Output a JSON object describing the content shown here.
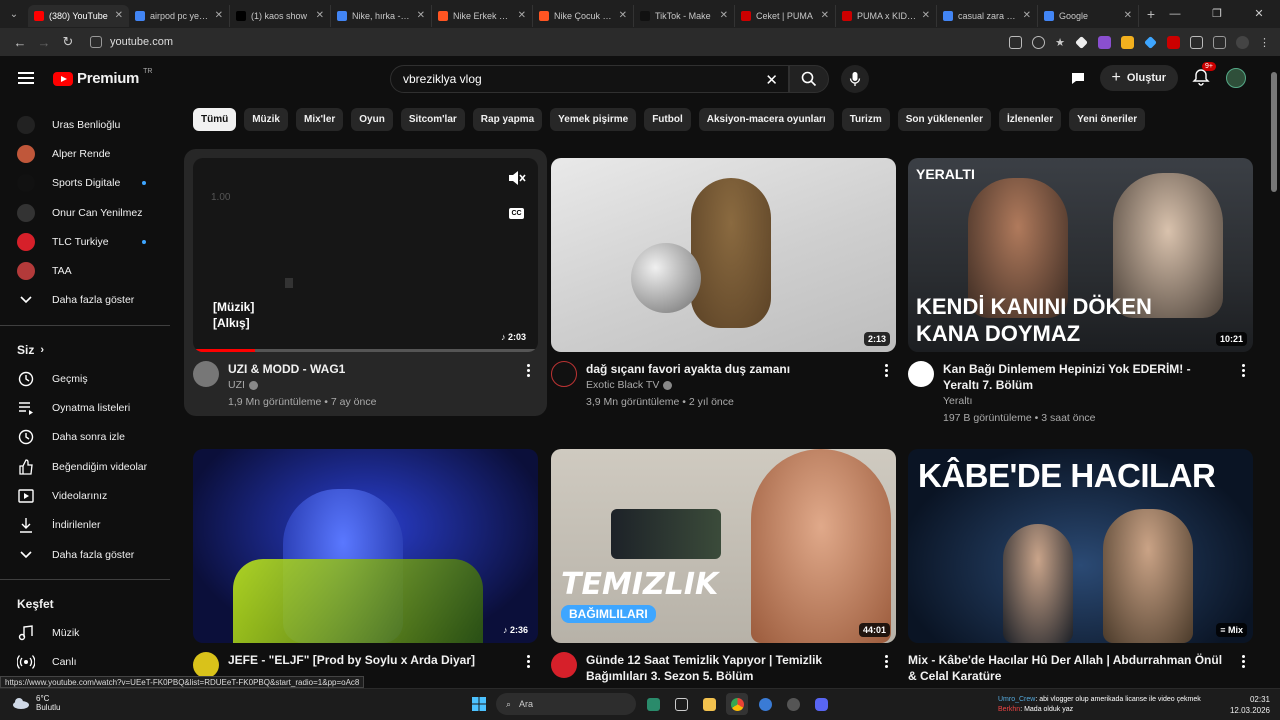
{
  "browser": {
    "tabs": [
      {
        "title": "(380) YouTube",
        "color": "#ff0000",
        "active": true
      },
      {
        "title": "airpod pc ye nasıl",
        "color": "#4285f4",
        "active": false
      },
      {
        "title": "(1) kaos show",
        "color": "#000000",
        "active": false
      },
      {
        "title": "Nike, hırka - Go",
        "color": "#4285f4",
        "active": false
      },
      {
        "title": "Nike Erkek Swe",
        "color": "#ff5522",
        "active": false
      },
      {
        "title": "Nike Çocuk Swe",
        "color": "#ff5522",
        "active": false
      },
      {
        "title": "TikTok - Make",
        "color": "#111111",
        "active": false
      },
      {
        "title": "Ceket | PUMA",
        "color": "#cc0000",
        "active": false
      },
      {
        "title": "PUMA x KIDSU",
        "color": "#cc0000",
        "active": false
      },
      {
        "title": "casual zara par",
        "color": "#4285f4",
        "active": false
      },
      {
        "title": "Google",
        "color": "#4285f4",
        "active": false
      }
    ],
    "url": "youtube.com"
  },
  "header": {
    "logo_text": "Premium",
    "logo_region": "TR",
    "search_value": "vbreziklya vlog",
    "create_label": "Oluştur",
    "notif_badge": "9+"
  },
  "sidebar": {
    "subscriptions": [
      {
        "label": "Uras Benlioğlu",
        "color": "#222222",
        "dot": false
      },
      {
        "label": "Alper Rende",
        "color": "#c0573a",
        "dot": false
      },
      {
        "label": "Sports Digitale",
        "color": "#111111",
        "dot": true
      },
      {
        "label": "Onur Can Yenilmez",
        "color": "#333333",
        "dot": false
      },
      {
        "label": "TLC Turkiye",
        "color": "#d6202a",
        "dot": true
      },
      {
        "label": "TAA",
        "color": "#b33a3a",
        "dot": false
      }
    ],
    "show_more": "Daha fazla göster",
    "you_title": "Siz",
    "you_items": [
      {
        "label": "Geçmiş",
        "icon": "history-icon"
      },
      {
        "label": "Oynatma listeleri",
        "icon": "playlists-icon"
      },
      {
        "label": "Daha sonra izle",
        "icon": "watch-later-icon"
      },
      {
        "label": "Beğendiğim videolar",
        "icon": "like-icon"
      },
      {
        "label": "Videolarınız",
        "icon": "your-videos-icon"
      },
      {
        "label": "İndirilenler",
        "icon": "downloads-icon"
      }
    ],
    "show_more_2": "Daha fazla göster",
    "explore_title": "Keşfet",
    "explore_items": [
      {
        "label": "Müzik",
        "icon": "music-icon"
      },
      {
        "label": "Canlı",
        "icon": "live-icon"
      }
    ]
  },
  "chips": [
    "Tümü",
    "Müzik",
    "Mix'ler",
    "Oyun",
    "Sitcom'lar",
    "Rap yapma",
    "Yemek pişirme",
    "Futbol",
    "Aksiyon-macera oyunları",
    "Turizm",
    "Son yüklenenler",
    "İzlenenler",
    "Yeni öneriler"
  ],
  "videos": [
    {
      "title": "UZI & MODD - WAG1",
      "channel": "UZI",
      "verified": true,
      "stats": "1,9 Mn görüntüleme • 7 ay önce",
      "duration": "2:03",
      "preview_caption_1": "[Müzik]",
      "preview_caption_2": "[Alkış]",
      "preview_time": "1.00",
      "progress": 0.18
    },
    {
      "title": "dağ sıçanı favori ayakta duş zamanı",
      "channel": "Exotic Black TV",
      "verified": true,
      "stats": "3,9 Mn görüntüleme • 2 yıl önce",
      "duration": "2:13"
    },
    {
      "title": "Kan Bağı Dinlemem Hepinizi Yok EDERİM! - Yeraltı 7. Bölüm",
      "channel": "Yeraltı",
      "verified": false,
      "stats": "197 B görüntüleme • 3 saat önce",
      "duration": "10:21",
      "thumb_brand": "YERALTI",
      "thumb_caption_1": "KENDİ KANINI DÖKEN",
      "thumb_caption_2": "KANA DOYMAZ"
    },
    {
      "title": "JEFE - \"ELJF\" [Prod by Soylu x Arda Diyar]",
      "duration": "2:36"
    },
    {
      "title": "Günde 12 Saat Temizlik Yapıyor | Temizlik Bağımlıları 3. Sezon 5. Bölüm",
      "duration": "44:01",
      "thumb_caption_1": "TEMIZLIK",
      "thumb_caption_2": "BAĞIMLILARI"
    },
    {
      "title": "Mix - Kâbe'de Hacılar Hû Der Allah | Abdurrahman Önül & Celal Karatüre",
      "duration": "Mix",
      "thumb_caption_1": "KÂBE'DE HACILAR"
    }
  ],
  "status_url": "https://www.youtube.com/watch?v=UEeT-FK0PBQ&list=RDUEeT-FK0PBQ&start_radio=1&pp=oAc8",
  "taskbar": {
    "temp": "6°C",
    "weather": "Bulutlu",
    "search_label": "Ara",
    "notif_line1_user": "Umro_Crew",
    "notif_line1_text": ": abi vlogger olup amerikada licanse ile video çekmek",
    "notif_line2_user": "Berkhn",
    "notif_line2_text": ": Mada olduk yaz",
    "time": "02:31",
    "date": "12.03.2026"
  }
}
